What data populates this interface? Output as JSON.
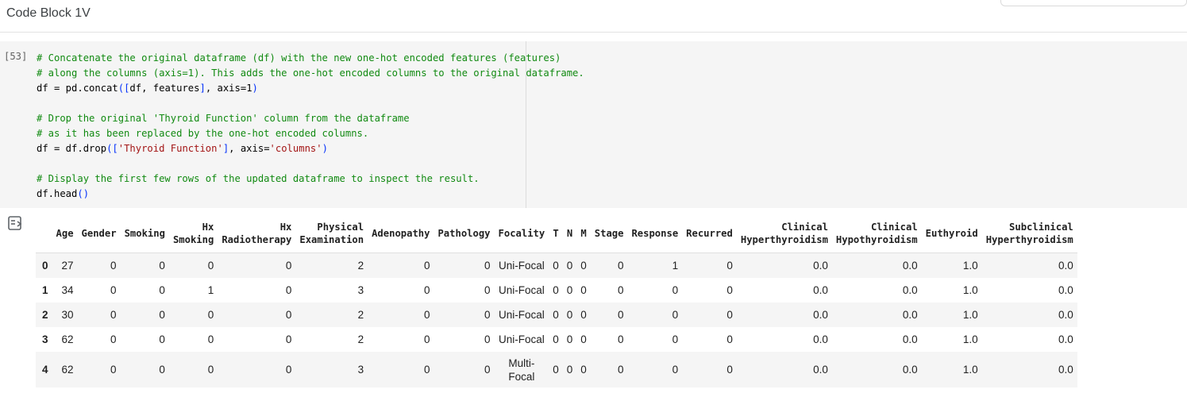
{
  "header": {
    "title": "Code Block 1V"
  },
  "cell": {
    "execution_count": "[53]",
    "code_lines": [
      [
        {
          "t": "# Concatenate the original dataframe (df) with the new one-hot encoded features (features)",
          "c": "cm"
        }
      ],
      [
        {
          "t": "# along the columns (axis=1). This adds the one-hot encoded columns to the original dataframe.",
          "c": "cm"
        }
      ],
      [
        {
          "t": "df = pd.concat",
          "c": ""
        },
        {
          "t": "([",
          "c": "pn"
        },
        {
          "t": "df, features",
          "c": ""
        },
        {
          "t": "]",
          "c": "pn"
        },
        {
          "t": ", axis=1",
          "c": ""
        },
        {
          "t": ")",
          "c": "pn"
        }
      ],
      [
        {
          "t": "",
          "c": ""
        }
      ],
      [
        {
          "t": "# Drop the original 'Thyroid Function' column from the dataframe",
          "c": "cm"
        }
      ],
      [
        {
          "t": "# as it has been replaced by the one-hot encoded columns.",
          "c": "cm"
        }
      ],
      [
        {
          "t": "df = df.drop",
          "c": ""
        },
        {
          "t": "([",
          "c": "pn"
        },
        {
          "t": "'Thyroid Function'",
          "c": "st"
        },
        {
          "t": "]",
          "c": "pn"
        },
        {
          "t": ", axis=",
          "c": ""
        },
        {
          "t": "'columns'",
          "c": "st"
        },
        {
          "t": ")",
          "c": "pn"
        }
      ],
      [
        {
          "t": "",
          "c": ""
        }
      ],
      [
        {
          "t": "# Display the first few rows of the updated dataframe to inspect the result.",
          "c": "cm"
        }
      ],
      [
        {
          "t": "df.head",
          "c": ""
        },
        {
          "t": "()",
          "c": "pn"
        }
      ]
    ]
  },
  "output": {
    "icon": "output-toggle-icon",
    "columns": [
      "",
      "Age",
      "Gender",
      "Smoking",
      "Hx Smoking",
      "Hx Radiotherapy",
      "Physical Examination",
      "Adenopathy",
      "Pathology",
      "Focality",
      "T",
      "N",
      "M",
      "Stage",
      "Response",
      "Recurred",
      "Clinical Hyperthyroidism",
      "Clinical Hypothyroidism",
      "Euthyroid",
      "Subclinical Hyperthyroidism"
    ],
    "rows": [
      [
        "0",
        "27",
        "0",
        "0",
        "0",
        "0",
        "2",
        "0",
        "0",
        "Uni-Focal",
        "0",
        "0",
        "0",
        "0",
        "1",
        "0",
        "0.0",
        "0.0",
        "1.0",
        "0.0"
      ],
      [
        "1",
        "34",
        "0",
        "0",
        "1",
        "0",
        "3",
        "0",
        "0",
        "Uni-Focal",
        "0",
        "0",
        "0",
        "0",
        "0",
        "0",
        "0.0",
        "0.0",
        "1.0",
        "0.0"
      ],
      [
        "2",
        "30",
        "0",
        "0",
        "0",
        "0",
        "2",
        "0",
        "0",
        "Uni-Focal",
        "0",
        "0",
        "0",
        "0",
        "0",
        "0",
        "0.0",
        "0.0",
        "1.0",
        "0.0"
      ],
      [
        "3",
        "62",
        "0",
        "0",
        "0",
        "0",
        "2",
        "0",
        "0",
        "Uni-Focal",
        "0",
        "0",
        "0",
        "0",
        "0",
        "0",
        "0.0",
        "0.0",
        "1.0",
        "0.0"
      ],
      [
        "4",
        "62",
        "0",
        "0",
        "0",
        "0",
        "3",
        "0",
        "0",
        "Multi-Focal",
        "0",
        "0",
        "0",
        "0",
        "0",
        "0",
        "0.0",
        "0.0",
        "1.0",
        "0.0"
      ]
    ]
  }
}
